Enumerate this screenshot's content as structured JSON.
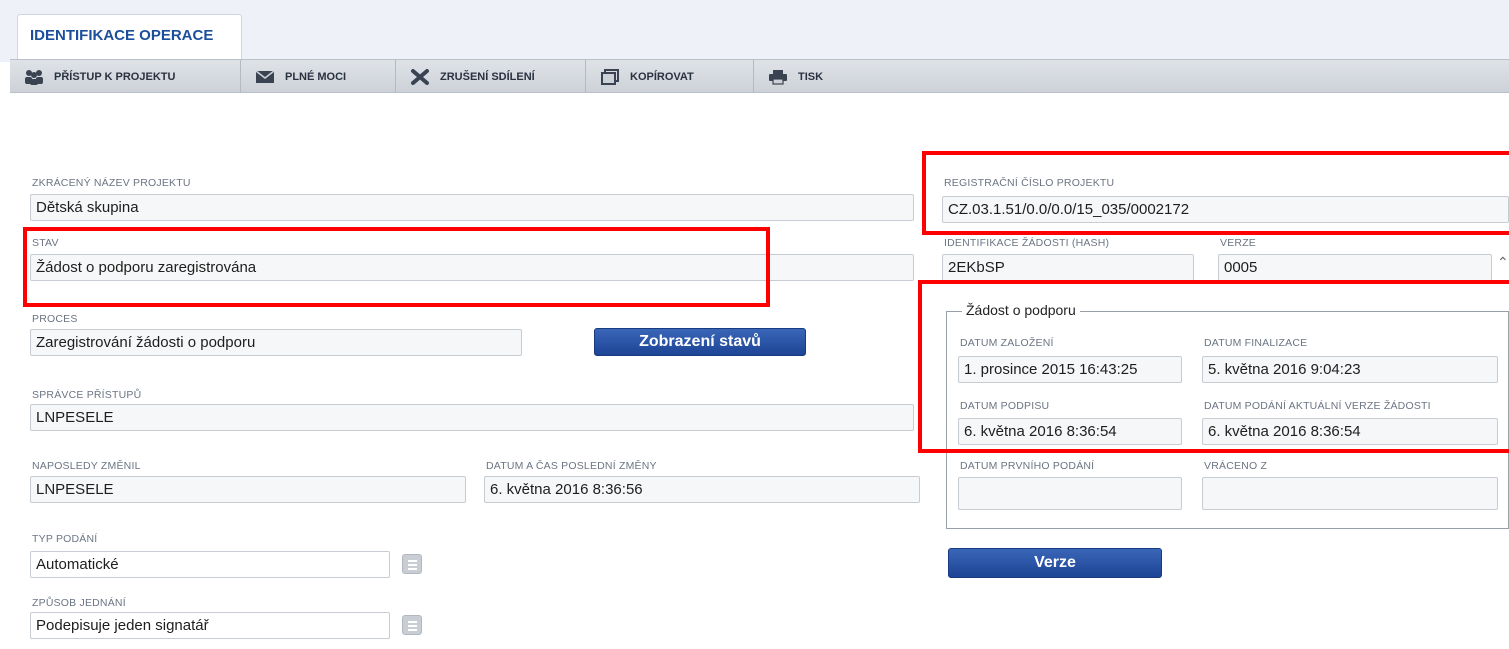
{
  "tab": {
    "label": "IDENTIFIKACE OPERACE"
  },
  "toolbar": [
    {
      "label": "PŘÍSTUP K PROJEKTU",
      "icon": "users-icon"
    },
    {
      "label": "PLNÉ MOCI",
      "icon": "envelope-icon"
    },
    {
      "label": "ZRUŠENÍ SDÍLENÍ",
      "icon": "cross-icon"
    },
    {
      "label": "KOPÍROVAT",
      "icon": "copy-icon"
    },
    {
      "label": "TISK",
      "icon": "printer-icon"
    }
  ],
  "left": {
    "short_name": {
      "label": "ZKRÁCENÝ NÁZEV PROJEKTU",
      "value": "Dětská skupina"
    },
    "state": {
      "label": "STAV",
      "value": "Žádost o podporu zaregistrována"
    },
    "process": {
      "label": "PROCES",
      "value": "Zaregistrování žádosti o podporu"
    },
    "show_states_button": "Zobrazení stavů",
    "access_admin": {
      "label": "SPRÁVCE PŘÍSTUPŮ",
      "value": "LNPESELE"
    },
    "last_changed_by": {
      "label": "NAPOSLEDY ZMĚNIL",
      "value": "LNPESELE"
    },
    "last_change_time": {
      "label": "DATUM A ČAS POSLEDNÍ ZMĚNY",
      "value": "6. května 2016 8:36:56"
    },
    "submission_type": {
      "label": "TYP PODÁNÍ",
      "value": "Automatické"
    },
    "acting_method": {
      "label": "ZPŮSOB JEDNÁNÍ",
      "value": "Podepisuje jeden signatář"
    }
  },
  "right": {
    "registration_number": {
      "label": "REGISTRAČNÍ ČÍSLO PROJEKTU",
      "value": "CZ.03.1.51/0.0/0.0/15_035/0002172"
    },
    "request_hash": {
      "label": "IDENTIFIKACE ŽÁDOSTI (HASH)",
      "value": "2EKbSP"
    },
    "version": {
      "label": "VERZE",
      "value": "0005"
    },
    "request_group": {
      "legend": "Žádost o podporu",
      "created": {
        "label": "DATUM ZALOŽENÍ",
        "value": "1. prosince 2015 16:43:25"
      },
      "finalized": {
        "label": "DATUM FINALIZACE",
        "value": "5. května 2016 9:04:23"
      },
      "signed": {
        "label": "DATUM PODPISU",
        "value": "6. května 2016 8:36:54"
      },
      "current_submitted": {
        "label": "DATUM PODÁNÍ AKTUÁLNÍ VERZE ŽÁDOSTI",
        "value": "6. května 2016 8:36:54"
      },
      "first_submitted": {
        "label": "DATUM PRVNÍHO PODÁNÍ",
        "value": ""
      },
      "returned_from": {
        "label": "VRÁCENO Z",
        "value": ""
      }
    },
    "versions_button": "Verze"
  },
  "colors": {
    "accent": "#1d4495",
    "highlight": "#ff0000",
    "tab_text": "#1b4f9c"
  }
}
